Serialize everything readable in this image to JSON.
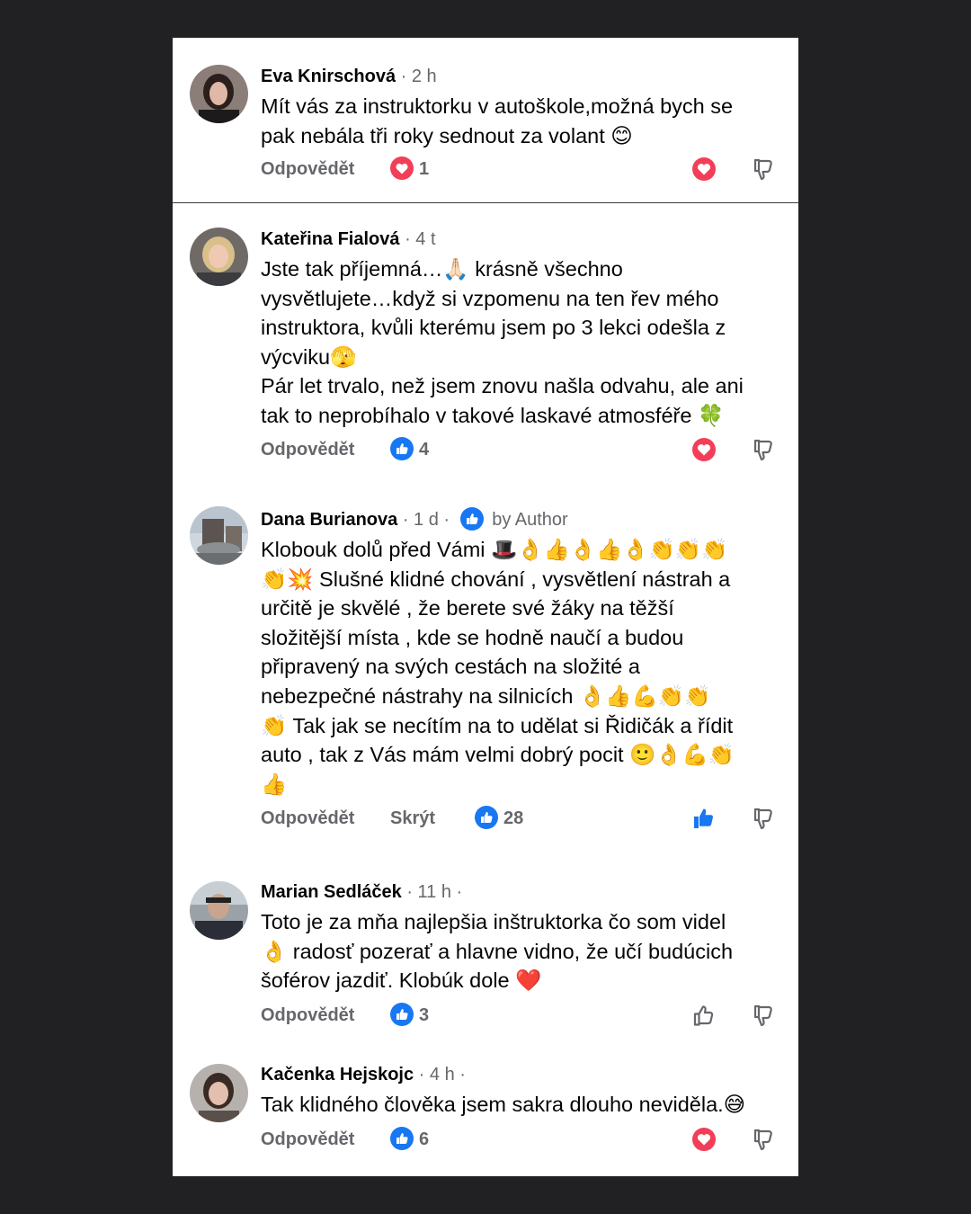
{
  "comments": [
    {
      "name": "Eva Knirschová",
      "time": "· 2 h",
      "text": [
        "Mít vás za instruktorku v autoškole,možná bych se",
        "pak nebála tři roky sednout za volant 😊"
      ],
      "reply_label": "Odpovědět",
      "reaction_icon": "heart-icon",
      "reaction_count": "1",
      "my_reaction": "heart-icon"
    },
    {
      "name": "Kateřina Fialová",
      "time": "· 4 t",
      "text": [
        "Jste tak příjemná…🙏🏻 krásně všechno",
        "vysvětlujete…když si vzpomenu na ten řev mého",
        "instruktora, kvůli kterému jsem po 3 lekci odešla z",
        "výcviku🫣",
        "Pár let trvalo, než jsem znovu našla odvahu, ale ani",
        "tak to neprobíhalo v takové laskavé atmosféře 🍀"
      ],
      "reply_label": "Odpovědět",
      "reaction_icon": "like-icon",
      "reaction_count": "4",
      "my_reaction": "heart-icon"
    },
    {
      "name": "Dana Burianova",
      "time": "· 1 d ·",
      "author_label": "by Author",
      "text": [
        "Klobouk dolů před Vámi 🎩👌👍👌👍👌👏👏👏",
        "👏💥  Slušné klidné chování , vysvětlení nástrah a",
        "určitě je skvělé , že berete své žáky na těžší",
        "složitější místa , kde se hodně naučí a budou",
        "připravený na svých cestách na složité a",
        "nebezpečné nástrahy na silnicích 👌👍💪👏👏",
        "👏 Tak jak se necítím na to udělat si Řidičák a řídit",
        "auto , tak z Vás mám velmi dobrý pocit 🙂👌💪👏",
        "👍"
      ],
      "reply_label": "Odpovědět",
      "hide_label": "Skrýt",
      "reaction_icon": "like-icon",
      "reaction_count": "28",
      "my_reaction": "like-filled-icon"
    },
    {
      "name": "Marian Sedláček",
      "time": "· 11 h ·",
      "text": [
        "Toto je za mňa najlepšia inštruktorka čo som videl",
        "👌 radosť pozerať a hlavne vidno, že učí budúcich",
        "šoférov jazdiť. Klobúk dole ❤️"
      ],
      "reply_label": "Odpovědět",
      "reaction_icon": "like-icon",
      "reaction_count": "3",
      "my_reaction": "like-outline-icon"
    },
    {
      "name": "Kačenka Hejskojc",
      "time": "· 4 h ·",
      "text": [
        "Tak klidného člověka jsem sakra dlouho neviděla.😅"
      ],
      "reply_label": "Odpovědět",
      "reaction_icon": "like-icon",
      "reaction_count": "6",
      "my_reaction": "heart-icon"
    }
  ],
  "colors": {
    "name": "#050505",
    "meta": "#65676b",
    "like_blue": "#1877f2",
    "heart_red": "#f33e58",
    "outer_background": "#212123"
  }
}
